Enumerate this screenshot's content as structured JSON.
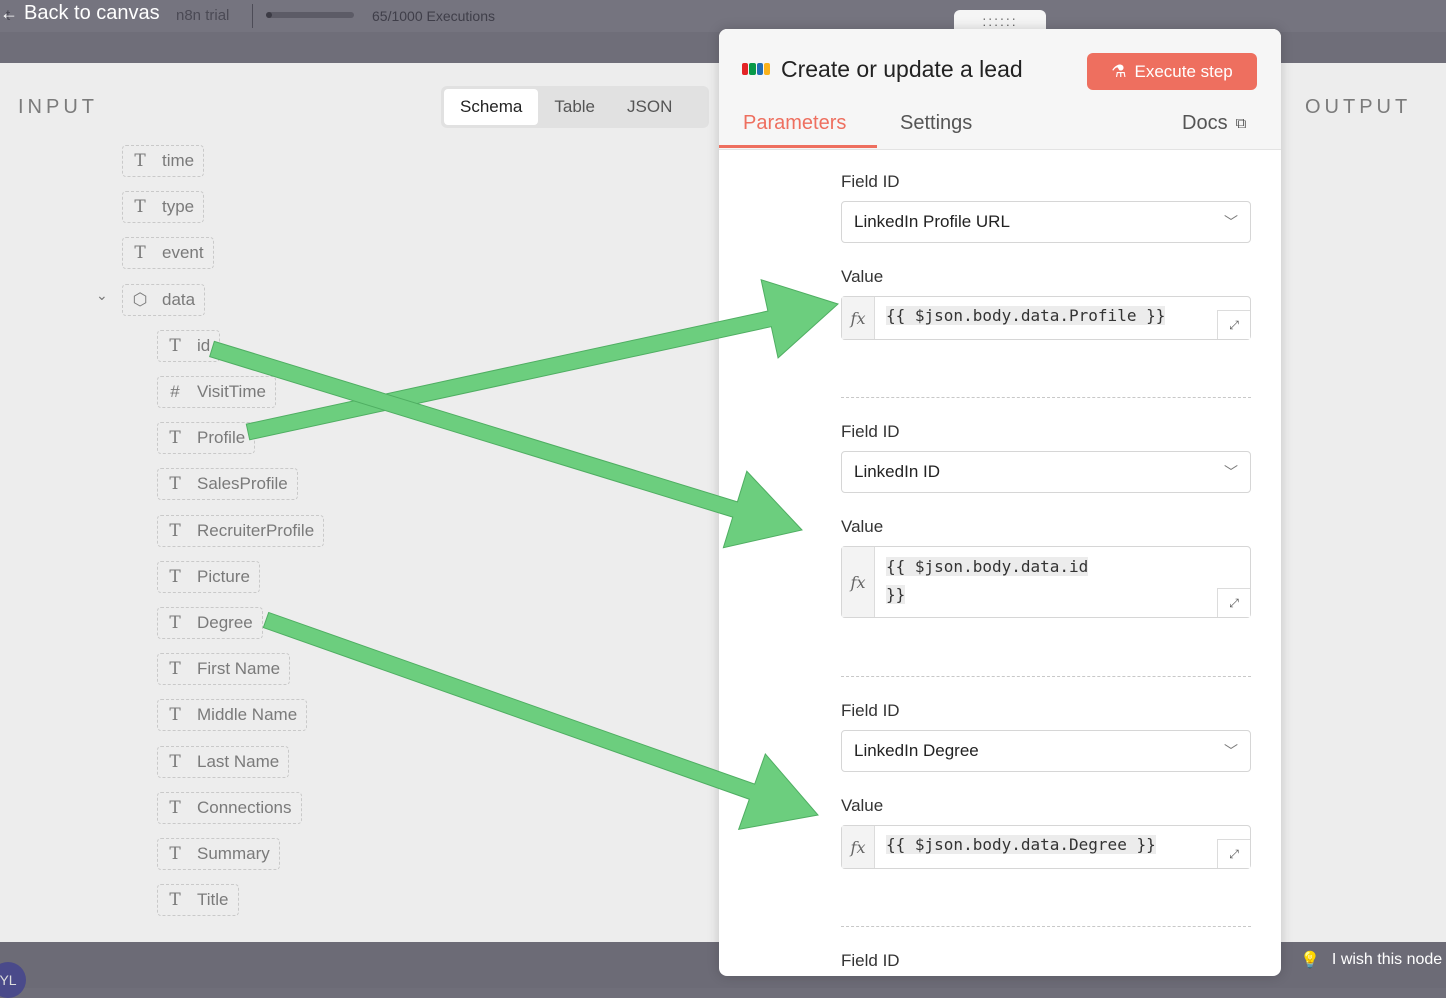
{
  "header": {
    "back_label": "Back to canvas",
    "trial_prefix": "t",
    "trial_label": "n8n trial",
    "executions_label": "65/1000 Executions",
    "executions_used": 65,
    "executions_total": 1000
  },
  "input_panel": {
    "title": "INPUT",
    "view_tabs": [
      "Schema",
      "Table",
      "JSON"
    ],
    "active_view": "Schema",
    "schema_items": [
      {
        "type": "T",
        "name": "time"
      },
      {
        "type": "T",
        "name": "type"
      },
      {
        "type": "T",
        "name": "event"
      },
      {
        "type": "object",
        "name": "data"
      },
      {
        "type": "T",
        "name": "id"
      },
      {
        "type": "#",
        "name": "VisitTime"
      },
      {
        "type": "T",
        "name": "Profile"
      },
      {
        "type": "T",
        "name": "SalesProfile"
      },
      {
        "type": "T",
        "name": "RecruiterProfile"
      },
      {
        "type": "T",
        "name": "Picture"
      },
      {
        "type": "T",
        "name": "Degree"
      },
      {
        "type": "T",
        "name": "First Name"
      },
      {
        "type": "T",
        "name": "Middle Name"
      },
      {
        "type": "T",
        "name": "Last Name"
      },
      {
        "type": "T",
        "name": "Connections"
      },
      {
        "type": "T",
        "name": "Summary"
      },
      {
        "type": "T",
        "name": "Title"
      }
    ]
  },
  "output_panel": {
    "title": "OUTPUT"
  },
  "node": {
    "title": "Create or update a lead",
    "execute_label": "Execute step",
    "tabs": [
      "Parameters",
      "Settings"
    ],
    "active_tab": "Parameters",
    "docs_label": "Docs",
    "accent_color": "#ee6f5f",
    "fields": [
      {
        "field_label": "Field ID",
        "field_value": "LinkedIn Profile URL",
        "value_label": "Value",
        "expression": "{{ $json.body.data.Profile }}"
      },
      {
        "field_label": "Field ID",
        "field_value": "LinkedIn ID",
        "value_label": "Value",
        "expression": "{{ $json.body.data.id\n}}"
      },
      {
        "field_label": "Field ID",
        "field_value": "LinkedIn Degree",
        "value_label": "Value",
        "expression": "{{ $json.body.data.Degree }}"
      },
      {
        "field_label": "Field ID"
      }
    ]
  },
  "footer": {
    "avatar_initials": "YL",
    "wish_label": "I wish this node would..."
  },
  "annotation_color": "#6cce7e"
}
